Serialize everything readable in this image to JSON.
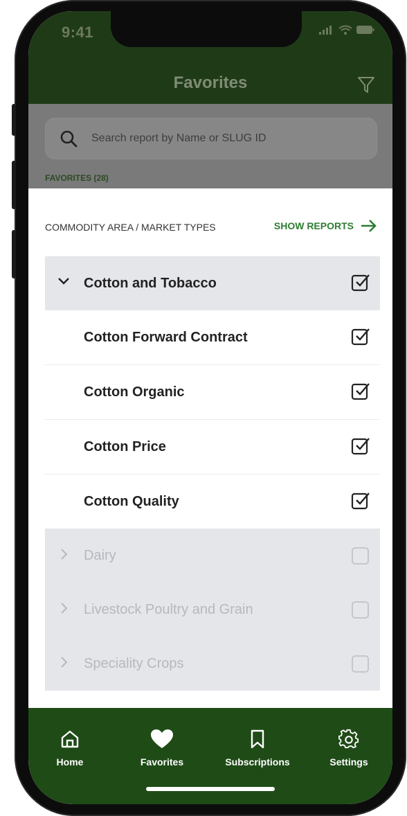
{
  "status_bar": {
    "time": "9:41",
    "icons": [
      "signal-icon",
      "wifi-icon",
      "battery-icon"
    ]
  },
  "header": {
    "title": "Favorites",
    "filter_icon": "filter-icon"
  },
  "search": {
    "placeholder": "Search report by Name or SLUG ID",
    "icon": "search-icon"
  },
  "favorites_count": "FAVORITES (28)",
  "sheet": {
    "heading": "COMMODITY AREA / MARKET TYPES",
    "action_label": "SHOW REPORTS",
    "items": [
      {
        "label": "Cotton and Tobacco",
        "type": "group",
        "expanded": true,
        "checked": true
      },
      {
        "label": "Cotton Forward Contract",
        "type": "child",
        "checked": true
      },
      {
        "label": "Cotton Organic",
        "type": "child",
        "checked": true
      },
      {
        "label": "Cotton Price",
        "type": "child",
        "checked": true
      },
      {
        "label": "Cotton Quality",
        "type": "child",
        "checked": true
      },
      {
        "label": "Dairy",
        "type": "group",
        "expanded": false,
        "checked": false
      },
      {
        "label": "Livestock Poultry and Grain",
        "type": "group",
        "expanded": false,
        "checked": false
      },
      {
        "label": "Speciality Crops",
        "type": "group",
        "expanded": false,
        "checked": false
      }
    ]
  },
  "tabbar": {
    "tabs": [
      {
        "label": "Home",
        "icon": "home-icon",
        "active": false
      },
      {
        "label": "Favorites",
        "icon": "heart-icon",
        "active": true
      },
      {
        "label": "Subscriptions",
        "icon": "bookmark-icon",
        "active": false
      },
      {
        "label": "Settings",
        "icon": "gear-icon",
        "active": false
      }
    ]
  },
  "colors": {
    "header_bg": "#1f3a17",
    "tabbar_bg": "#1f4b17",
    "accent_green": "#2e7d32",
    "group_row_bg": "#e5e6ea",
    "dim_overlay": "#7a7a7a"
  }
}
